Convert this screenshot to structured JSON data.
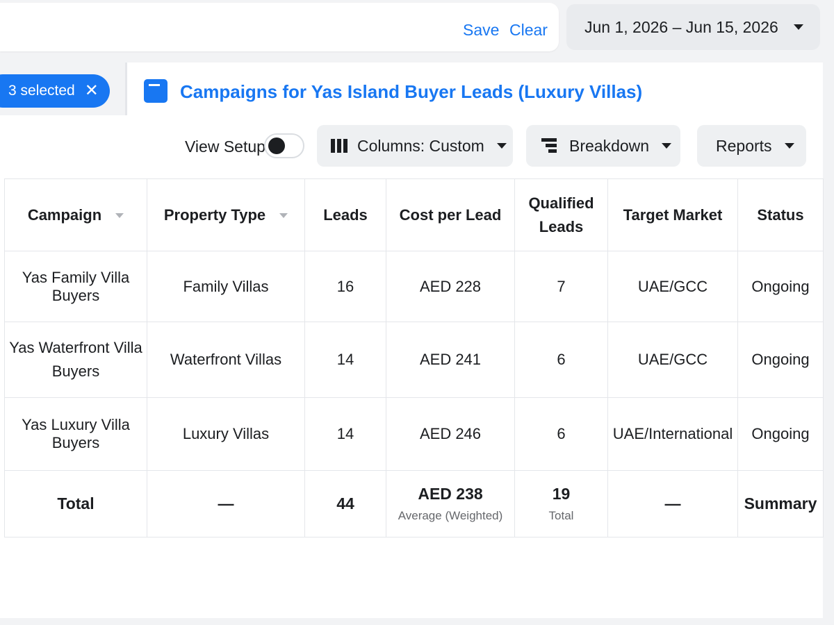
{
  "header": {
    "save_label": "Save",
    "clear_label": "Clear",
    "date_range": "Jun 1, 2026 – Jun 15, 2026"
  },
  "selection": {
    "label": "3 selected",
    "close_glyph": "✕"
  },
  "panel": {
    "title": "Campaigns for Yas Island Buyer Leads (Luxury Villas)",
    "view_setup_label": "View Setup",
    "view_setup_on": false,
    "columns_label": "Columns: Custom",
    "breakdown_label": "Breakdown",
    "reports_label": "Reports"
  },
  "table": {
    "headers": [
      "Campaign",
      "Property Type",
      "Leads",
      "Cost per Lead",
      "Qualified Leads",
      "Target Market",
      "Status"
    ],
    "rows": [
      [
        "Yas Family Villa Buyers",
        "Family Villas",
        "16",
        "AED 228",
        "7",
        "UAE/GCC",
        "Ongoing"
      ],
      [
        "Yas Waterfront Villa Buyers",
        "Waterfront Villas",
        "14",
        "AED 241",
        "6",
        "UAE/GCC",
        "Ongoing"
      ],
      [
        "Yas Luxury Villa Buyers",
        "Luxury Villas",
        "14",
        "AED 246",
        "6",
        "UAE/International",
        "Ongoing"
      ]
    ],
    "total": {
      "label": "Total",
      "property_type": "—",
      "leads": "44",
      "cost_per_lead": "AED 238",
      "cost_per_lead_note": "Average (Weighted)",
      "qualified_leads": "19",
      "qualified_leads_note": "Total",
      "target_market": "—",
      "status": "Summary"
    }
  },
  "colors": {
    "accent": "#1877f2",
    "background": "#f2f3f5",
    "button_bg": "#eef0f2"
  }
}
